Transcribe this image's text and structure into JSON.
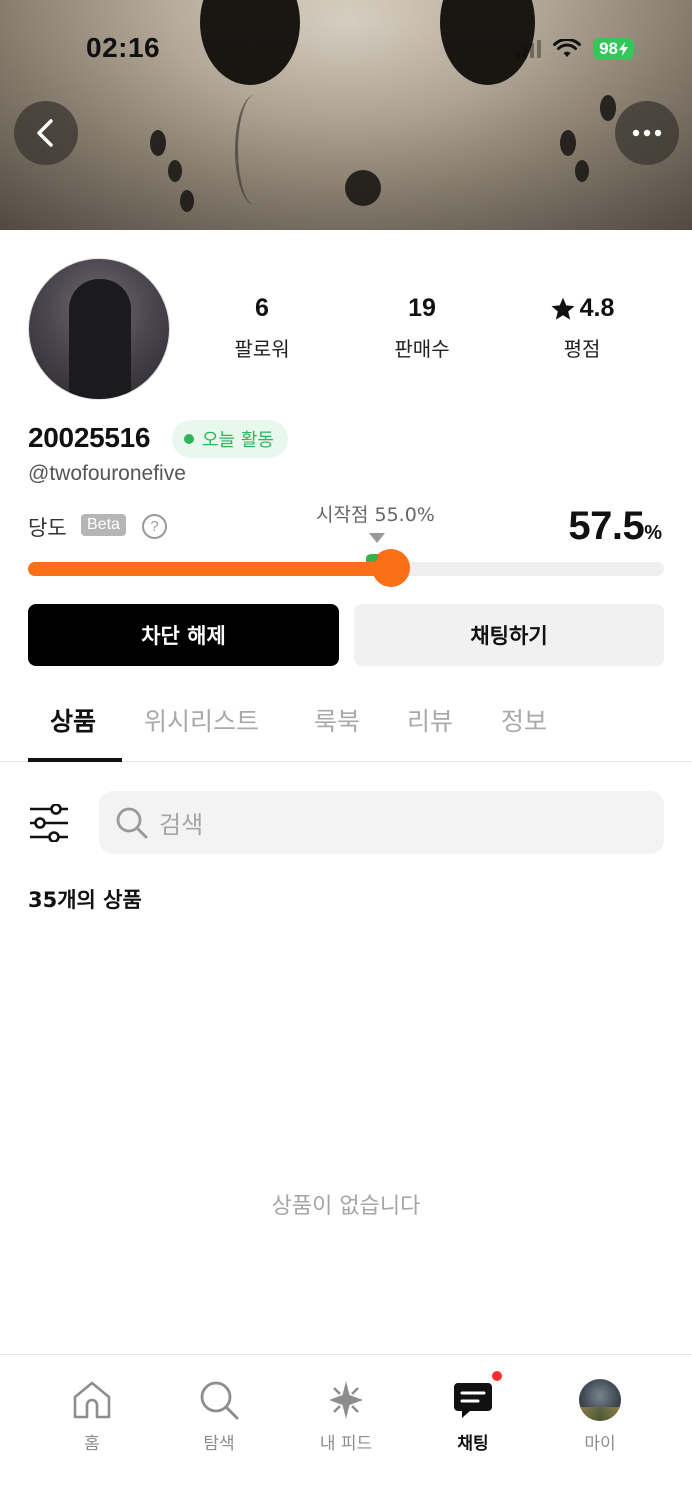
{
  "status_bar": {
    "time": "02:16",
    "battery": "98"
  },
  "profile": {
    "stats": [
      {
        "value": "6",
        "label": "팔로워"
      },
      {
        "value": "19",
        "label": "판매수"
      },
      {
        "value": "4.8",
        "label": "평점"
      }
    ],
    "username": "20025516",
    "active_badge": "오늘 활동",
    "handle": "@twofouronefive",
    "sweetness": {
      "label": "당도",
      "beta": "Beta",
      "help": "?",
      "start_point": "시작점 55.0%",
      "value": "57.5",
      "unit": "%",
      "fill_percent": 57.5,
      "start_percent": 55.0
    }
  },
  "actions": {
    "unblock": "차단 해제",
    "chat": "채팅하기"
  },
  "tabs": [
    "상품",
    "위시리스트",
    "룩북",
    "리뷰",
    "정보"
  ],
  "search": {
    "placeholder": "검색"
  },
  "product_count": "35개의 상품",
  "empty_message": "상품이 없습니다",
  "bottom_nav": [
    {
      "label": "홈",
      "icon": "home-icon"
    },
    {
      "label": "탐색",
      "icon": "search-icon"
    },
    {
      "label": "내 피드",
      "icon": "sparkle-icon"
    },
    {
      "label": "채팅",
      "icon": "chat-icon"
    },
    {
      "label": "마이",
      "icon": "avatar"
    }
  ],
  "colors": {
    "accent": "#fb6f17",
    "active_green": "#2db55d",
    "notification": "#ff2d2d"
  }
}
